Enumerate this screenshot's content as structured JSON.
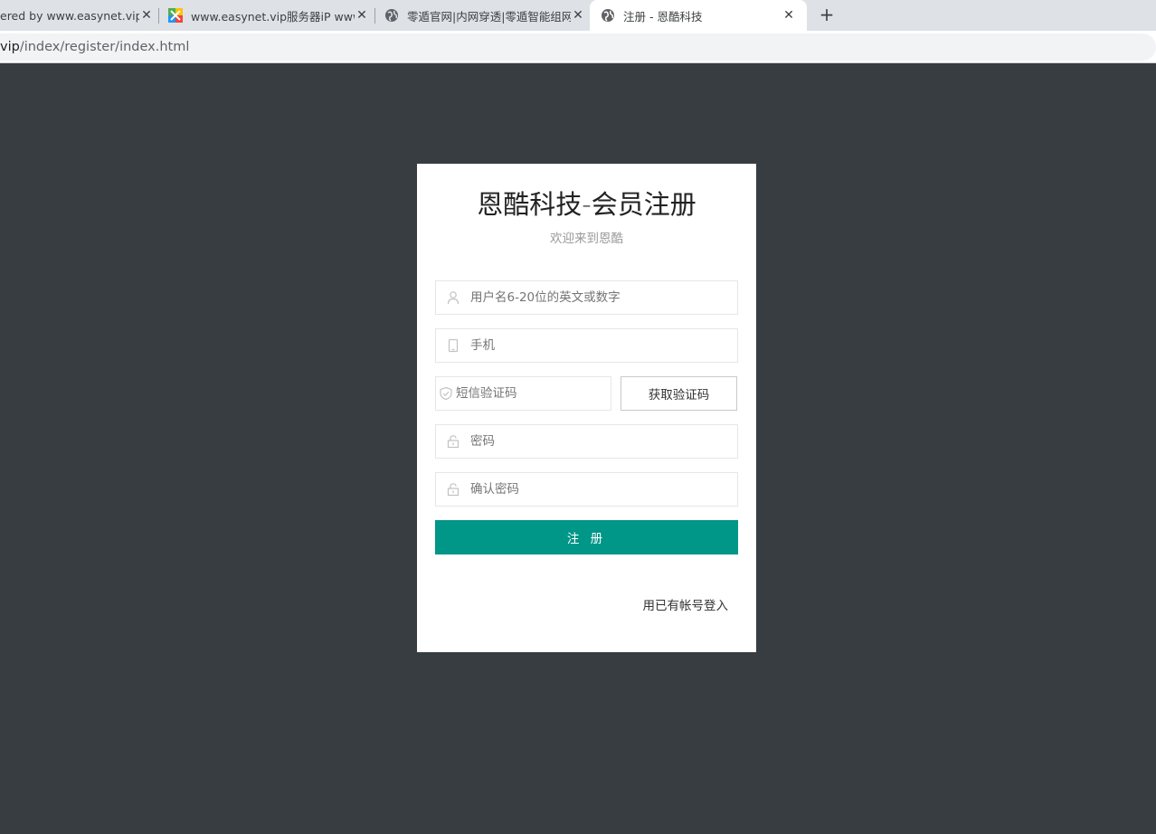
{
  "browser": {
    "tabs": [
      {
        "title": "ered by www.easynet.vip_",
        "active": false
      },
      {
        "title": "www.easynet.vip服务器iP www.",
        "active": false
      },
      {
        "title": "零遁官网|内网穿透|零遁智能组网",
        "active": false
      },
      {
        "title": "注册 - 恩酷科技",
        "active": true
      }
    ],
    "close_glyph": "✕",
    "new_tab_glyph": "+",
    "url_host": "vip",
    "url_path": "/index/register/index.html"
  },
  "register": {
    "title": "恩酷科技-会员注册",
    "subtitle": "欢迎来到恩酷",
    "username_placeholder": "用户名6-20位的英文或数字",
    "phone_placeholder": "手机",
    "sms_placeholder": "短信验证码",
    "get_code_label": "获取验证码",
    "password_placeholder": "密码",
    "confirm_placeholder": "确认密码",
    "submit_label": "注 册",
    "login_link": "用已有帐号登入"
  },
  "colors": {
    "page_bg": "#383d41",
    "accent": "#009688",
    "tabbar_bg": "#dee1e6"
  }
}
